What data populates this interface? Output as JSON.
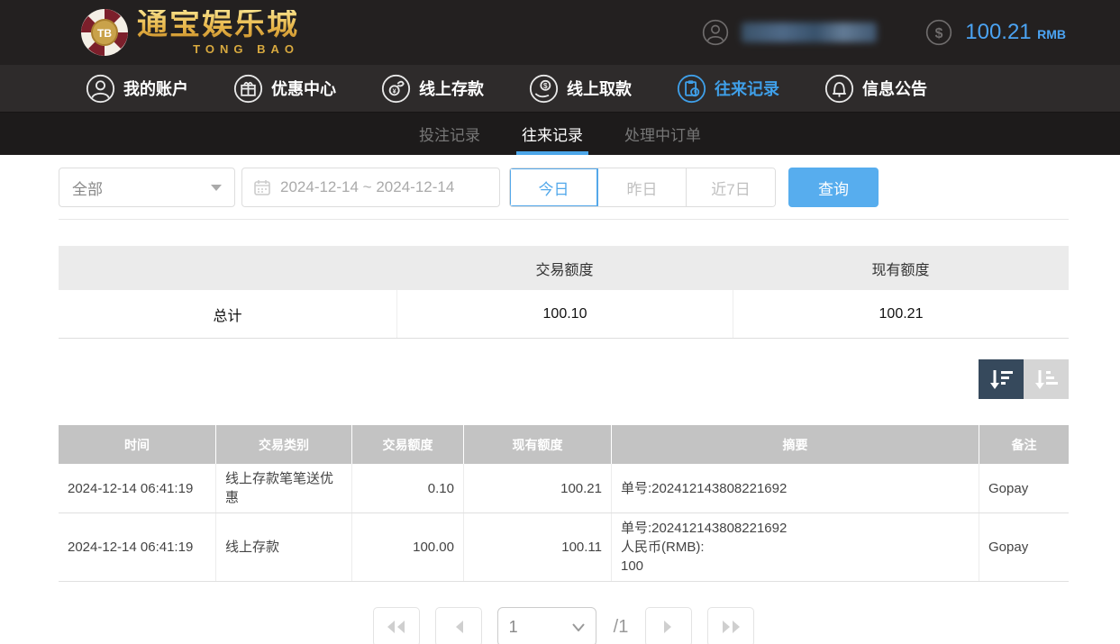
{
  "header": {
    "logo": {
      "chip_text": "TB",
      "brand_cn": "通宝娱乐城",
      "brand_en": "TONG BAO"
    },
    "balance": {
      "amount": "100.21",
      "currency": "RMB"
    }
  },
  "nav": {
    "items": [
      {
        "label": "我的账户",
        "icon": "user-icon",
        "active": false
      },
      {
        "label": "优惠中心",
        "icon": "gift-icon",
        "active": false
      },
      {
        "label": "线上存款",
        "icon": "deposit-icon",
        "active": false
      },
      {
        "label": "线上取款",
        "icon": "withdraw-icon",
        "active": false
      },
      {
        "label": "往来记录",
        "icon": "records-icon",
        "active": true
      },
      {
        "label": "信息公告",
        "icon": "bell-icon",
        "active": false
      }
    ]
  },
  "tabs": [
    {
      "label": "投注记录",
      "active": false
    },
    {
      "label": "往来记录",
      "active": true
    },
    {
      "label": "处理中订单",
      "active": false
    }
  ],
  "filters": {
    "type_select_value": "全部",
    "date_range_value": "2024-12-14 ~ 2024-12-14",
    "quick_buttons": [
      "今日",
      "昨日",
      "近7日"
    ],
    "active_quick_button": "今日",
    "query_label": "查询"
  },
  "summary": {
    "headers": [
      "",
      "交易额度",
      "现有额度"
    ],
    "row": {
      "label": "总计",
      "trade_amount": "100.10",
      "current_amount": "100.21"
    }
  },
  "table": {
    "headers": [
      "时间",
      "交易类别",
      "交易额度",
      "现有额度",
      "摘要",
      "备注"
    ],
    "rows": [
      {
        "time": "2024-12-14 06:41:19",
        "type": "线上存款笔笔送优惠",
        "amount": "0.10",
        "balance": "100.21",
        "summary": "单号:202412143808221692",
        "note": "Gopay"
      },
      {
        "time": "2024-12-14 06:41:19",
        "type": "线上存款",
        "amount": "100.00",
        "balance": "100.11",
        "summary": "单号:202412143808221692\n人民币(RMB):\n100",
        "note": "Gopay"
      }
    ]
  },
  "pagination": {
    "current_page": "1",
    "total_label": "/1"
  },
  "colors": {
    "accent_blue": "#4ca6e8",
    "query_button": "#57adee",
    "balance_blue": "#4ba3f2",
    "topbar_bg": "#232020",
    "navbar_bg": "#2e2b2b",
    "tabbar_bg": "#1d1b1b",
    "table_header_bg": "#c3c3c3",
    "summary_header_bg": "#ebebeb",
    "sort_active_bg": "#36495c",
    "sort_inactive_bg": "#d5d5d5",
    "logo_gold": "#e8b64a"
  }
}
